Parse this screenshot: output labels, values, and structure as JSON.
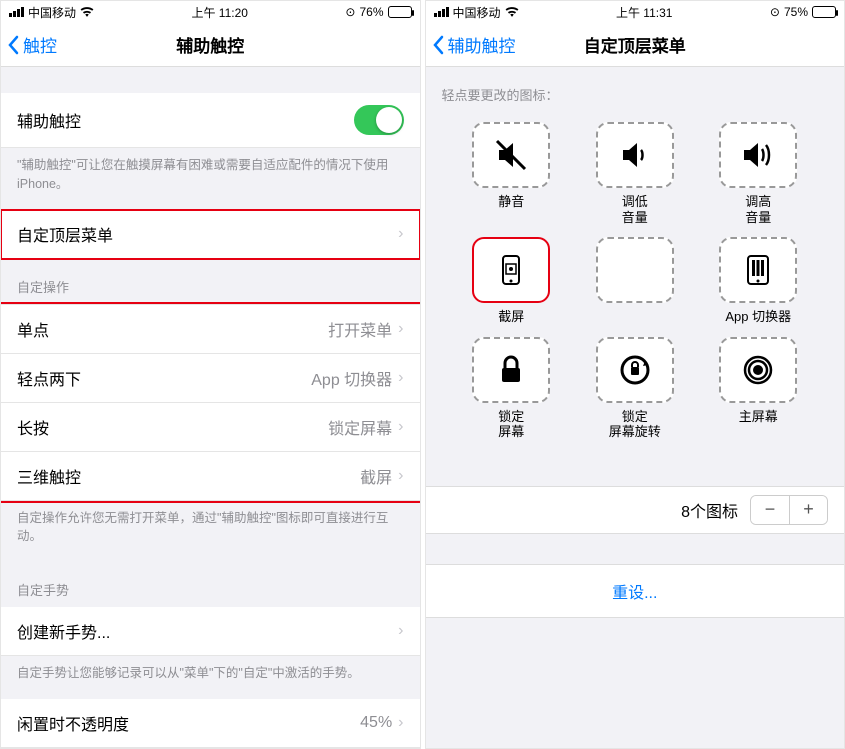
{
  "left": {
    "status": {
      "carrier": "中国移动",
      "time": "上午 11:20",
      "battery": "76%"
    },
    "nav": {
      "back": "触控",
      "title": "辅助触控"
    },
    "toggle": {
      "label": "辅助触控"
    },
    "toggle_footer": "\"辅助触控\"可让您在触摸屏幕有困难或需要自适应配件的情况下使用 iPhone。",
    "custom_menu": {
      "label": "自定顶层菜单"
    },
    "section_actions": "自定操作",
    "actions": [
      {
        "label": "单点",
        "value": "打开菜单"
      },
      {
        "label": "轻点两下",
        "value": "App 切换器"
      },
      {
        "label": "长按",
        "value": "锁定屏幕"
      },
      {
        "label": "三维触控",
        "value": "截屏"
      }
    ],
    "actions_footer": "自定操作允许您无需打开菜单，通过\"辅助触控\"图标即可直接进行互动。",
    "section_gestures": "自定手势",
    "gesture_create": "创建新手势...",
    "gesture_footer": "自定手势让您能够记录可以从\"菜单\"下的\"自定\"中激活的手势。",
    "opacity": {
      "label": "闲置时不透明度",
      "value": "45%"
    }
  },
  "right": {
    "status": {
      "carrier": "中国移动",
      "time": "上午 11:31",
      "battery": "75%"
    },
    "nav": {
      "back": "辅助触控",
      "title": "自定顶层菜单"
    },
    "hint": "轻点要更改的图标：",
    "icons": [
      {
        "name": "mute-icon",
        "label": "静音"
      },
      {
        "name": "volume-down-icon",
        "label": "调低\n音量"
      },
      {
        "name": "volume-up-icon",
        "label": "调高\n音量"
      },
      {
        "name": "screenshot-icon",
        "label": "截屏"
      },
      {
        "name": "empty-slot",
        "label": ""
      },
      {
        "name": "app-switcher-icon",
        "label": "App 切换器"
      },
      {
        "name": "lock-screen-icon",
        "label": "锁定\n屏幕"
      },
      {
        "name": "rotation-lock-icon",
        "label": "锁定\n屏幕旋转"
      },
      {
        "name": "home-icon",
        "label": "主屏幕"
      }
    ],
    "count": "8个图标",
    "reset": "重设..."
  }
}
